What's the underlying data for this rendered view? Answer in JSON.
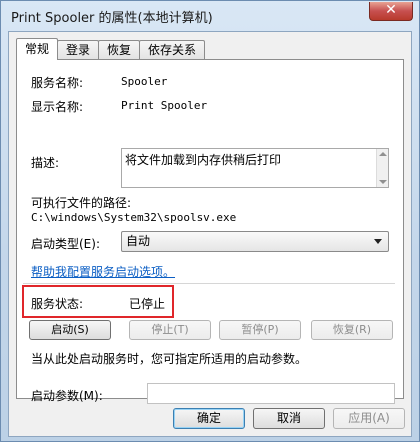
{
  "window": {
    "title": "Print Spooler 的属性(本地计算机)",
    "close_glyph": "✕"
  },
  "tabs": [
    {
      "label": "常规",
      "active": true
    },
    {
      "label": "登录",
      "active": false
    },
    {
      "label": "恢复",
      "active": false
    },
    {
      "label": "依存关系",
      "active": false
    }
  ],
  "general": {
    "service_name_label": "服务名称:",
    "service_name_value": "Spooler",
    "display_name_label": "显示名称:",
    "display_name_value": "Print Spooler",
    "description_label": "描述:",
    "description_value": "将文件加载到内存供稍后打印",
    "exe_path_label": "可执行文件的路径:",
    "exe_path_value": "C:\\windows\\System32\\spoolsv.exe",
    "startup_type_label": "启动类型(E):",
    "startup_type_value": "自动",
    "help_link": "帮助我配置服务启动选项。",
    "status_label": "服务状态:",
    "status_value": "已停止",
    "buttons": {
      "start": "启动(S)",
      "stop": "停止(T)",
      "pause": "暂停(P)",
      "resume": "恢复(R)"
    },
    "hint_text": "当从此处启动服务时，您可指定所适用的启动参数。",
    "start_params_label": "启动参数(M):",
    "start_params_value": ""
  },
  "footer": {
    "ok": "确定",
    "cancel": "取消",
    "apply": "应用(A)"
  },
  "colors": {
    "highlight": "#e0262a",
    "link": "#0b5ec4"
  }
}
